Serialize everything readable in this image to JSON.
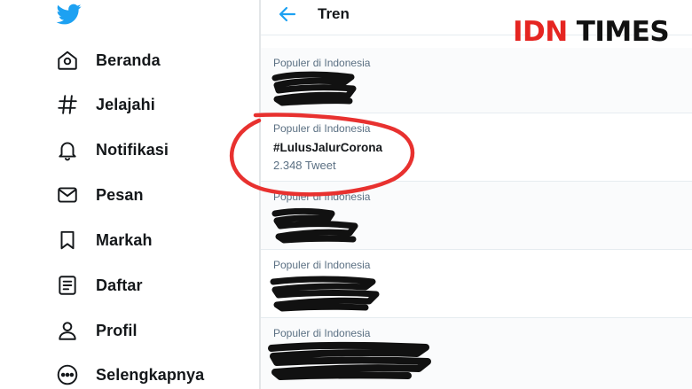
{
  "sidebar": {
    "logo": "twitter-bird-icon",
    "items": [
      {
        "label": "Beranda",
        "icon": "home-icon"
      },
      {
        "label": "Jelajahi",
        "icon": "hashtag-icon"
      },
      {
        "label": "Notifikasi",
        "icon": "bell-icon"
      },
      {
        "label": "Pesan",
        "icon": "mail-icon"
      },
      {
        "label": "Markah",
        "icon": "bookmark-icon"
      },
      {
        "label": "Daftar",
        "icon": "list-icon"
      },
      {
        "label": "Profil",
        "icon": "person-icon"
      },
      {
        "label": "Selengkapnya",
        "icon": "more-icon"
      }
    ]
  },
  "header": {
    "back_icon": "back-arrow-icon",
    "title": "Tren"
  },
  "trends": [
    {
      "context": "Populer di Indonesia",
      "name": "",
      "count": "",
      "redacted": true
    },
    {
      "context": "Populer di Indonesia",
      "name": "#LulusJalurCorona",
      "count": "2.348 Tweet",
      "redacted": false
    },
    {
      "context": "Populer di Indonesia",
      "name": "",
      "count": "",
      "redacted": true
    },
    {
      "context": "Populer di Indonesia",
      "name": "",
      "count": "",
      "redacted": true
    },
    {
      "context": "Populer di Indonesia",
      "name": "",
      "count": "",
      "redacted": true
    }
  ],
  "watermark": {
    "part1": "IDN",
    "part2": "TIMES"
  },
  "colors": {
    "accent": "#1da1f2",
    "annotation": "#e8312f",
    "brand_red": "#e52521",
    "secondary_text": "#5b7083"
  }
}
